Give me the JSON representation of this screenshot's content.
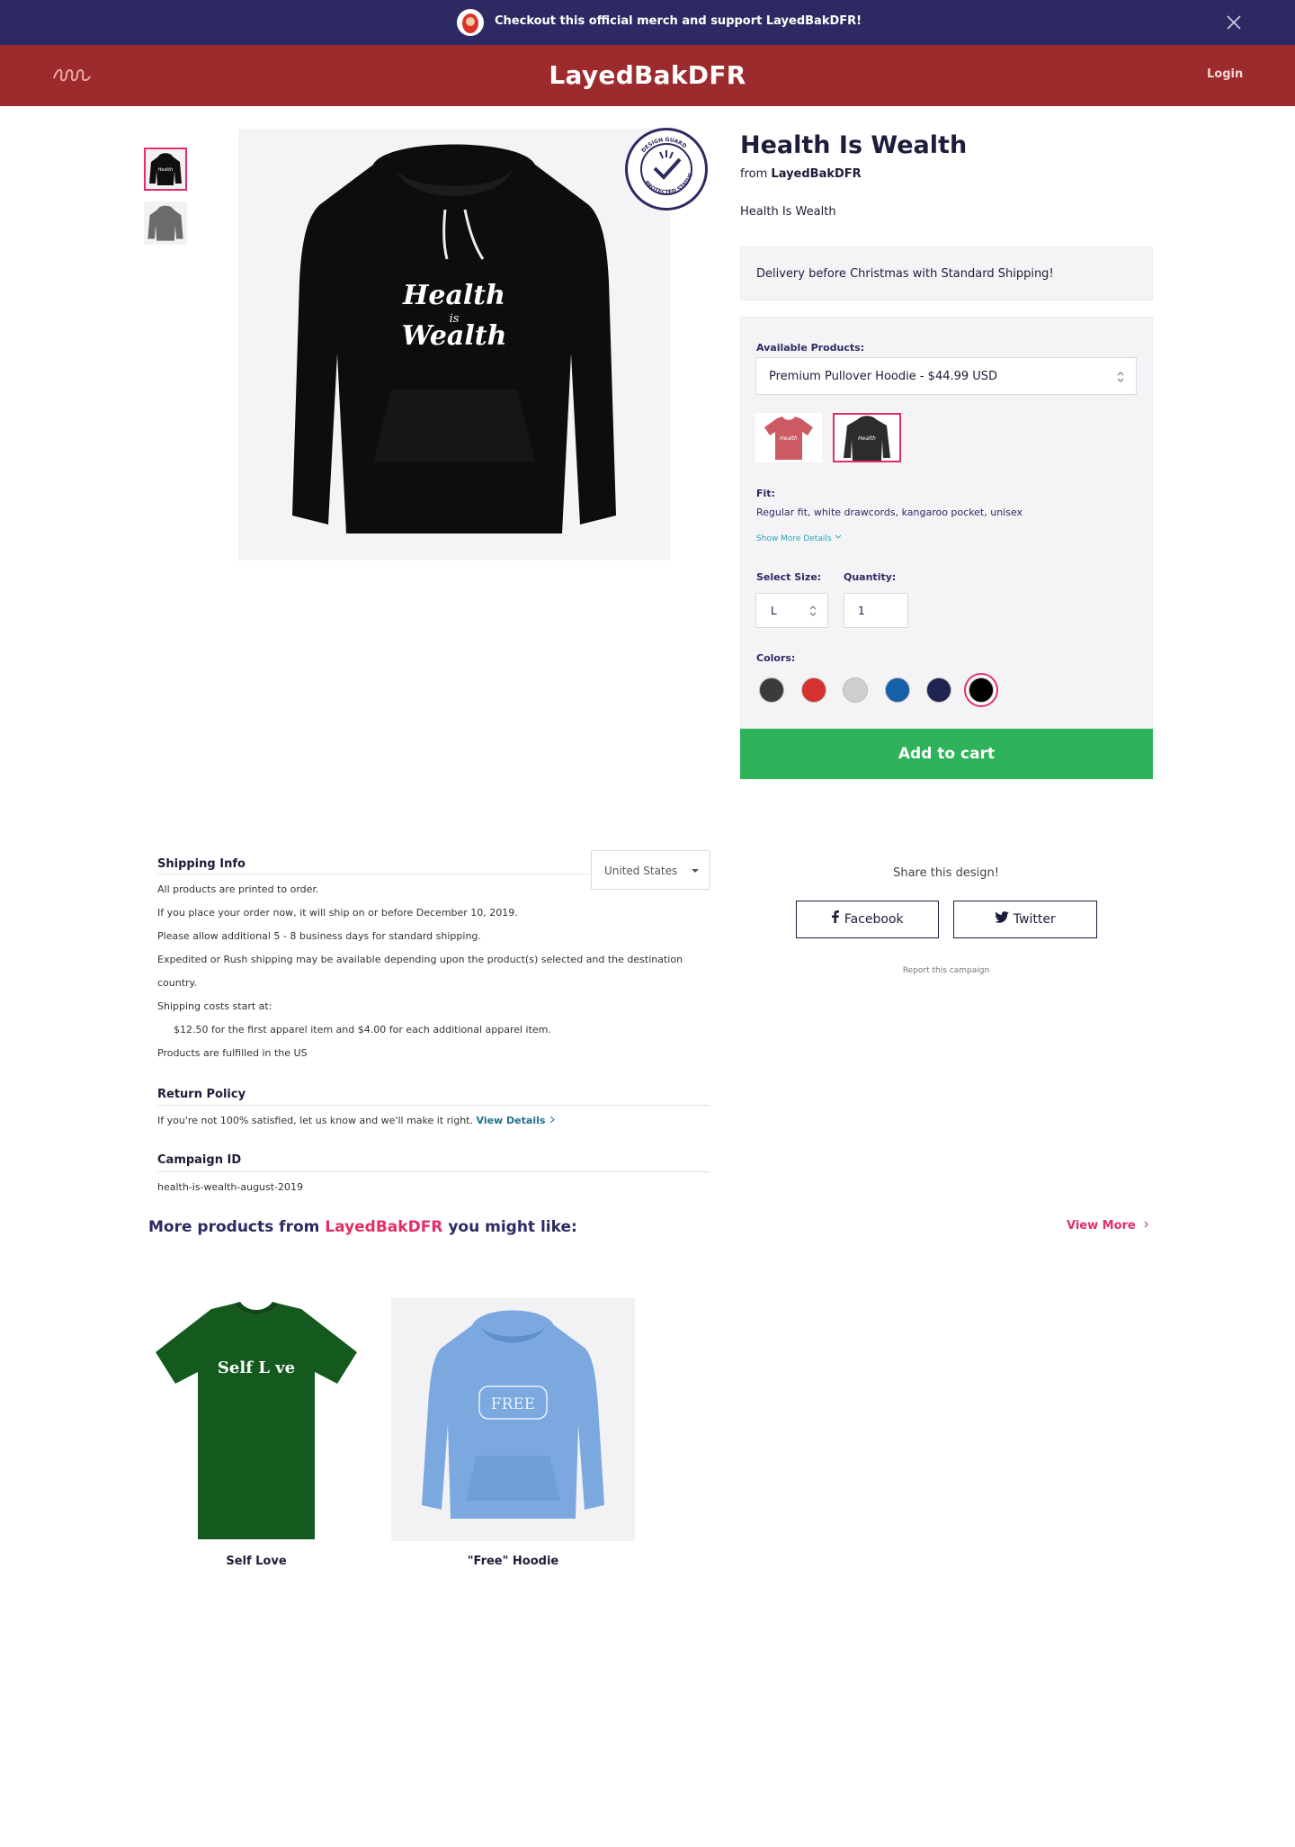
{
  "promo": {
    "message": "Checkout this official merch and support LayedBakDFR!"
  },
  "nav": {
    "brand": "LayedBakDFR",
    "login": "Login"
  },
  "product": {
    "title": "Health Is Wealth",
    "from_prefix": "from",
    "seller": "LayedBakDFR",
    "description": "Health Is Wealth",
    "graphic_text_1": "Health",
    "graphic_text_2": "is",
    "graphic_text_3": "Wealth",
    "guard_text_top": "DESIGN GUARD",
    "guard_text_bottom": "PROTECTED STATUS"
  },
  "delivery_notice": "Delivery before Christmas with Standard Shipping!",
  "options": {
    "available_label": "Available Products:",
    "product_select": "Premium Pullover Hoodie - $44.99 USD",
    "fit_label": "Fit:",
    "fit_text": "Regular fit, white drawcords, kangaroo pocket, unisex",
    "show_more": "Show More Details",
    "size_label": "Select Size:",
    "size_value": "L",
    "quantity_label": "Quantity:",
    "quantity_value": "1",
    "colors_label": "Colors:",
    "colors": [
      "#3b3b3d",
      "#d5312f",
      "#cfcfcf",
      "#1560a8",
      "#1f2550",
      "#000000"
    ],
    "selected_color_index": 5
  },
  "cart": {
    "label": "Add to cart"
  },
  "shipping": {
    "title": "Shipping Info",
    "country": "United States",
    "lines": [
      "All products are printed to order.",
      "If you place your order now, it will ship on or before December 10, 2019.",
      "Please allow additional 5 - 8 business days for standard shipping.",
      "Expedited or Rush shipping may be available depending upon the product(s) selected and the destination",
      "country.",
      "Shipping costs start at:"
    ],
    "cost_line": "$12.50 for the first apparel item and $4.00 for each additional apparel item.",
    "fulfilled": "Products are fulfilled in the US"
  },
  "returns": {
    "title": "Return Policy",
    "text": "If you're not 100% satisfied, let us know and we'll make it right.",
    "link": "View Details"
  },
  "campaign": {
    "title": "Campaign ID",
    "value": "health-is-wealth-august-2019"
  },
  "share": {
    "title": "Share this design!",
    "facebook": "Facebook",
    "twitter": "Twitter",
    "report": "Report this campaign"
  },
  "more": {
    "prefix": "More products from",
    "seller": "LayedBakDFR",
    "suffix": "you might like:",
    "view_more": "View More",
    "items": [
      {
        "name": "Self Love",
        "graphic": "Self L ve"
      },
      {
        "name": "\"Free\" Hoodie",
        "graphic": "FREE"
      }
    ]
  },
  "colors": {
    "promo_bg": "#2d2a63",
    "nav_bg": "#9d2b2d",
    "accent": "#e32e66",
    "cart": "#2eb35a",
    "teal": "#2aa7b7"
  }
}
